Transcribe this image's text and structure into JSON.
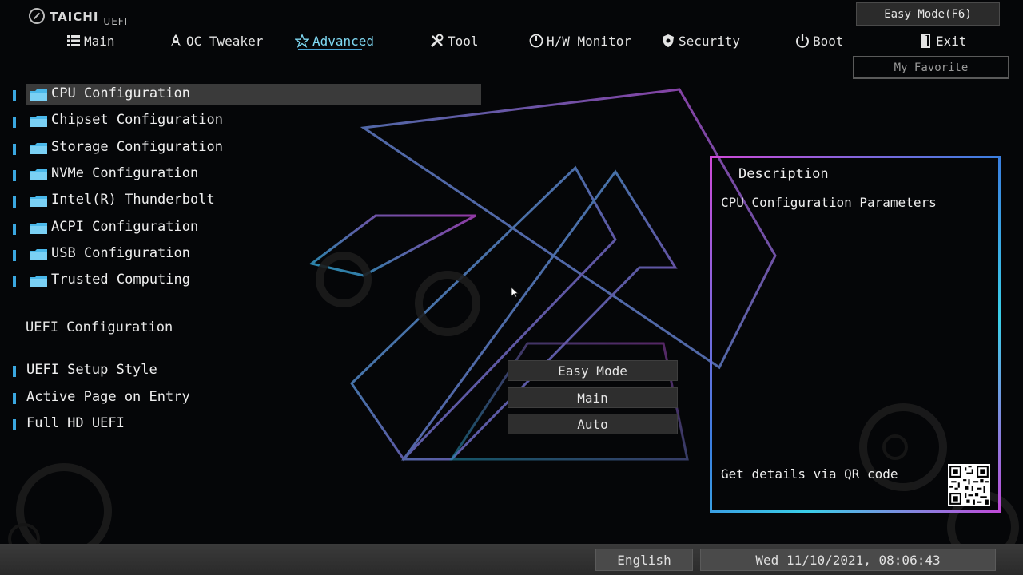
{
  "header": {
    "brand": "TAICHI",
    "sub": "UEFI"
  },
  "nav": {
    "main": "Main",
    "oc_tweaker": "OC Tweaker",
    "advanced": "Advanced",
    "tool": "Tool",
    "hw_monitor": "H/W Monitor",
    "security": "Security",
    "boot": "Boot",
    "exit": "Exit",
    "active": "Advanced"
  },
  "buttons": {
    "easy_mode": "Easy Mode(F6)",
    "my_favorite": "My Favorite"
  },
  "menu": {
    "items": [
      {
        "label": "CPU Configuration",
        "selected": true
      },
      {
        "label": "Chipset Configuration"
      },
      {
        "label": "Storage Configuration"
      },
      {
        "label": "NVMe Configuration"
      },
      {
        "label": "Intel(R) Thunderbolt"
      },
      {
        "label": "ACPI Configuration"
      },
      {
        "label": "USB Configuration"
      },
      {
        "label": "Trusted Computing"
      }
    ]
  },
  "uefi_section": {
    "title": "UEFI Configuration",
    "settings": [
      {
        "label": "UEFI Setup Style",
        "value": "Easy Mode"
      },
      {
        "label": "Active Page on Entry",
        "value": "Main"
      },
      {
        "label": "Full HD UEFI",
        "value": "Auto"
      }
    ]
  },
  "description": {
    "title": "Description",
    "text": "CPU Configuration Parameters",
    "qr_label": "Get details via QR code"
  },
  "footer": {
    "language": "English",
    "datetime": "Wed 11/10/2021, 08:06:43"
  },
  "colors": {
    "accent": "#3aa7e0",
    "active_tab": "#7fd8f2",
    "panel_border_start": "#d04ad8",
    "panel_border_end": "#3acfe8"
  }
}
